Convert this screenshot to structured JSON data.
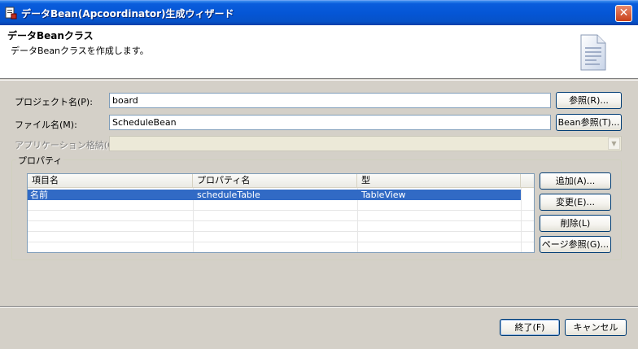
{
  "window": {
    "title": "データBean(Apcoordinator)生成ウィザード",
    "close_glyph": "✕"
  },
  "banner": {
    "title": "データBeanクラス",
    "description": "データBeanクラスを作成します。"
  },
  "form": {
    "project_label": "プロジェクト名(P):",
    "project_value": "board",
    "project_browse": "参照(R)...",
    "file_label": "ファイル名(M):",
    "file_value": "ScheduleBean",
    "file_browse": "Bean参照(T)...",
    "app_store_label": "アプリケーション格納(O):",
    "app_store_value": ""
  },
  "properties": {
    "group_label": "プロパティ",
    "columns": [
      "項目名",
      "プロパティ名",
      "型"
    ],
    "rows": [
      {
        "item": "名前",
        "property": "scheduleTable",
        "type": "TableView",
        "selected": true
      }
    ],
    "add_button": "追加(A)...",
    "edit_button": "変更(E)...",
    "delete_button": "削除(L)",
    "page_ref_button": "ページ参照(G)..."
  },
  "footer": {
    "finish_button": "終了(F)",
    "cancel_button": "キャンセル"
  },
  "colors": {
    "titlebar": "#0556d6",
    "selection": "#316ac5",
    "dialog_bg": "#d4d0c8"
  },
  "icons": {
    "title": "wizard-app-icon",
    "banner": "document-icon",
    "combo": "chevron-down-icon"
  }
}
